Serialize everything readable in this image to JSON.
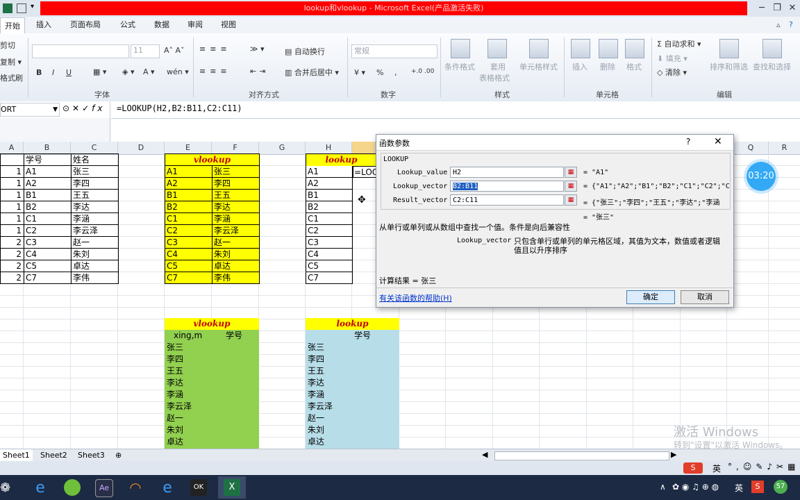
{
  "titlebar": {
    "title": "lookup和vlookup - Microsoft Excel(产品激活失败)",
    "min": "─",
    "restore": "❐",
    "close": "✕"
  },
  "tabs": [
    "开始",
    "插入",
    "页面布局",
    "公式",
    "数据",
    "审阅",
    "视图"
  ],
  "ribbon": {
    "clipboard": {
      "cut": "剪切",
      "copy": "复制 ▾",
      "format": "格式刷"
    },
    "font": {
      "size": "11",
      "bold": "B",
      "italic": "I",
      "underline": "U",
      "label": "字体"
    },
    "alignment": {
      "wrap": "自动换行",
      "merge": "合并后居中 ▾",
      "label": "对齐方式"
    },
    "number": {
      "format": "常规",
      "pct": "%",
      "comma": ",",
      "label": "数字"
    },
    "styles": {
      "cond": "条件格式",
      "table1": "套用",
      "table2": "表格格式",
      "cell": "单元格样式",
      "label": "样式"
    },
    "cells": {
      "insert": "插入",
      "delete": "删除",
      "format": "格式",
      "label": "单元格"
    },
    "editing": {
      "autosum": "自动求和 ▾",
      "fill": "填充 ▾",
      "clear": "清除 ▾",
      "sort": "排序和筛选",
      "find": "查找和选择",
      "label": "编辑"
    }
  },
  "formula_bar": {
    "name": "ORT",
    "formula": "=LOOKUP(H2,B2:B11,C2:C11)"
  },
  "columns": [
    "A",
    "B",
    "C",
    "D",
    "E",
    "F",
    "G",
    "H",
    "Q",
    "R"
  ],
  "table_left": {
    "header_id": "学号",
    "header_name": "姓名",
    "rows": [
      [
        "1",
        "A1",
        "张三"
      ],
      [
        "1",
        "A2",
        "李四"
      ],
      [
        "1",
        "B1",
        "王五"
      ],
      [
        "1",
        "B2",
        "李达"
      ],
      [
        "1",
        "C1",
        "李涵"
      ],
      [
        "1",
        "C2",
        "李云泽"
      ],
      [
        "2",
        "C3",
        "赵一"
      ],
      [
        "2",
        "C4",
        "朱刘"
      ],
      [
        "2",
        "C5",
        "卓达"
      ],
      [
        "2",
        "C7",
        "李伟"
      ]
    ]
  },
  "table_vlookup": {
    "title": "vlookup",
    "rows": [
      [
        "A1",
        "张三"
      ],
      [
        "A2",
        "李四"
      ],
      [
        "B1",
        "王五"
      ],
      [
        "B2",
        "李达"
      ],
      [
        "C1",
        "李涵"
      ],
      [
        "C2",
        "李云泽"
      ],
      [
        "C3",
        "赵一"
      ],
      [
        "C4",
        "朱刘"
      ],
      [
        "C5",
        "卓达"
      ],
      [
        "C7",
        "李伟"
      ]
    ]
  },
  "table_lookup": {
    "title": "lookup",
    "ids": [
      "A1",
      "A2",
      "B1",
      "B2",
      "C1",
      "C2",
      "C3",
      "C4",
      "C5",
      "C7"
    ],
    "cell_editing": "=LOOK"
  },
  "green_table": {
    "title": "vlookup",
    "h1": "xing,m",
    "h2": "学号",
    "names": [
      "张三",
      "李四",
      "王五",
      "李达",
      "李涵",
      "李云泽",
      "赵一",
      "朱刘",
      "卓达"
    ]
  },
  "blue_table": {
    "title": "lookup",
    "h2": "学号",
    "names": [
      "张三",
      "李四",
      "王五",
      "李达",
      "李涵",
      "李云泽",
      "赵一",
      "朱刘",
      "卓达"
    ]
  },
  "dialog": {
    "title": "函数参数",
    "help_q": "?",
    "close": "✕",
    "fn_name": "LOOKUP",
    "args": [
      {
        "label": "Lookup_value",
        "value": "H2",
        "result": "= \"A1\""
      },
      {
        "label": "Lookup_vector",
        "value": "B2:B11",
        "result": "= {\"A1\";\"A2\";\"B1\";\"B2\";\"C1\";\"C2\";\"C"
      },
      {
        "label": "Result_vector",
        "value": "C2:C11",
        "result": "= {\"张三\";\"李四\";\"王五\";\"李达\";\"李涵"
      }
    ],
    "overall_result": "= \"张三\"",
    "description": "从单行或单列或从数组中查找一个值。条件是向后兼容性",
    "arg_name": "Lookup_vector",
    "arg_desc1": "只包含单行或单列的单元格区域，其值为文本，数值或者逻辑",
    "arg_desc2": "值且以升序排序",
    "calc_result": "计算结果 = 张三",
    "help_link": "有关该函数的帮助(H)",
    "ok": "确定",
    "cancel": "取消"
  },
  "sheets": [
    "Sheet1",
    "Sheet2",
    "Sheet3"
  ],
  "watermark": {
    "line1": "激活 Windows",
    "line2": "转到\"设置\"以激活 Windows。"
  },
  "timer": "03:20",
  "tray": {
    "ime": "英",
    "ime2": "英",
    "badge": "57"
  }
}
